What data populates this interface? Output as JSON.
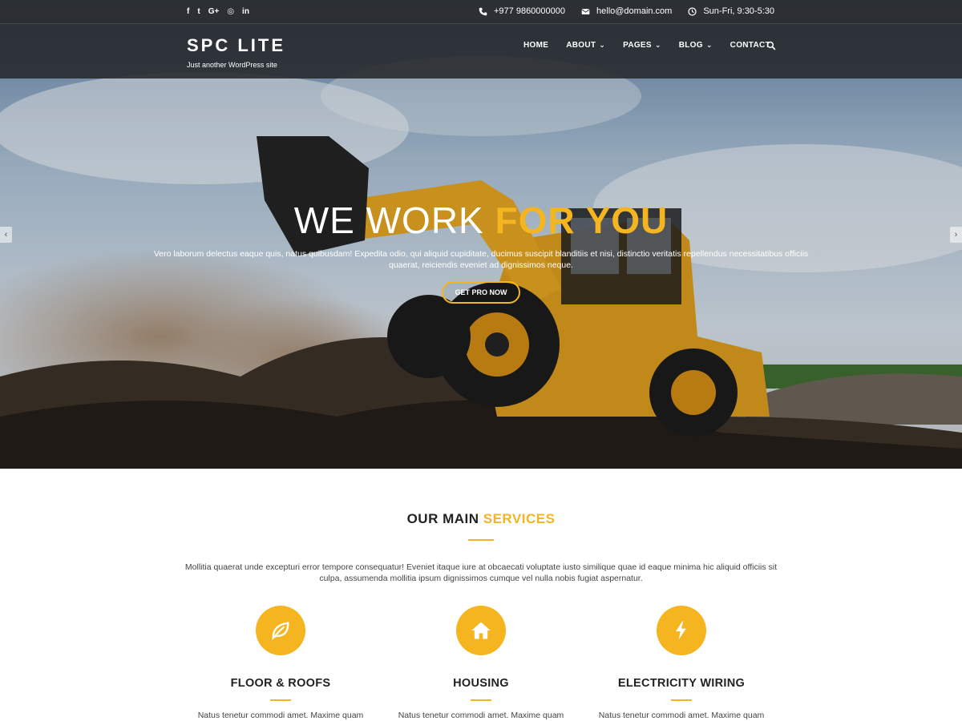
{
  "topbar": {
    "social": [
      "f",
      "t",
      "G+",
      "◎",
      "in"
    ],
    "social_names": [
      "facebook-icon",
      "twitter-icon",
      "google-plus-icon",
      "instagram-icon",
      "linkedin-icon"
    ],
    "phone": "+977 9860000000",
    "email": "hello@domain.com",
    "hours": "Sun-Fri, 9:30-5:30"
  },
  "header": {
    "logo": "SPC LITE",
    "tagline": "Just another WordPress site",
    "menu": [
      {
        "label": "HOME",
        "dropdown": false
      },
      {
        "label": "ABOUT",
        "dropdown": true
      },
      {
        "label": "PAGES",
        "dropdown": true
      },
      {
        "label": "BLOG",
        "dropdown": true
      },
      {
        "label": "CONTACT",
        "dropdown": false
      }
    ]
  },
  "hero": {
    "title_main": "WE WORK ",
    "title_accent": "FOR YOU",
    "text": "Vero laborum delectus eaque quis, natus quibusdam! Expedita odio, qui aliquid cupiditate, ducimus suscipit blanditiis et nisi, distinctio veritatis repellendus necessitatibus officiis quaerat, reiciendis eveniet ad dignissimos neque.",
    "button": "GET PRO NOW",
    "arrow_left": "‹",
    "arrow_right": "›"
  },
  "services": {
    "title_main": "OUR MAIN ",
    "title_accent": "SERVICES",
    "description": "Mollitia quaerat unde excepturi error tempore consequatur! Eveniet itaque iure at obcaecati voluptate iusto similique quae id eaque minima hic aliquid officiis sit culpa, assumenda mollitia ipsum dignissimos cumque vel nulla nobis fugiat aspernatur.",
    "items": [
      {
        "title": "FLOOR & ROOFS",
        "icon": "leaf-icon",
        "text": "Natus tenetur commodi amet. Maxime quam"
      },
      {
        "title": "HOUSING",
        "icon": "home-icon",
        "text": "Natus tenetur commodi amet. Maxime quam"
      },
      {
        "title": "ELECTRICITY WIRING",
        "icon": "bolt-icon",
        "text": "Natus tenetur commodi amet. Maxime quam"
      }
    ]
  },
  "colors": {
    "accent": "#f5b521",
    "header_bg": "#26282b",
    "text_dark": "#222222"
  }
}
